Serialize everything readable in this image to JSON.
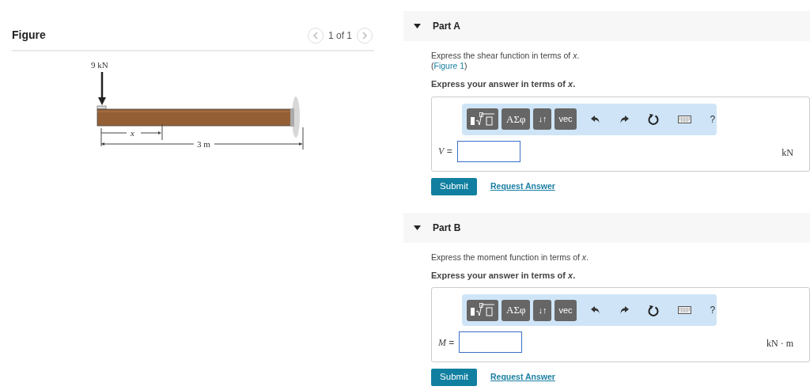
{
  "figure": {
    "title": "Figure",
    "pager": "1 of 1",
    "load_label": "9 kN",
    "x_label": "x",
    "length_label": "3 m"
  },
  "parts": [
    {
      "title": "Part A",
      "expanded": true,
      "prompt": "Express the shear function in terms of *x*.",
      "figure_link_open": "(",
      "figure_link": "Figure 1",
      "figure_link_close": ")",
      "instruction": "Express your answer in terms of *x*.",
      "toolbar": [
        "ΑΣφ",
        "↓↑",
        "vec",
        "?"
      ],
      "variable": "V",
      "equals": "=",
      "unit": "kN",
      "submit": "Submit",
      "request": "Request Answer"
    },
    {
      "title": "Part B",
      "expanded": true,
      "prompt": "Express the moment function in terms of *x*.",
      "instruction": "Express your answer in terms of *x*.",
      "toolbar": [
        "ΑΣφ",
        "↓↑",
        "vec",
        "?"
      ],
      "variable": "M",
      "equals": "=",
      "unit": "kN · m",
      "submit": "Submit",
      "request": "Request Answer"
    }
  ]
}
